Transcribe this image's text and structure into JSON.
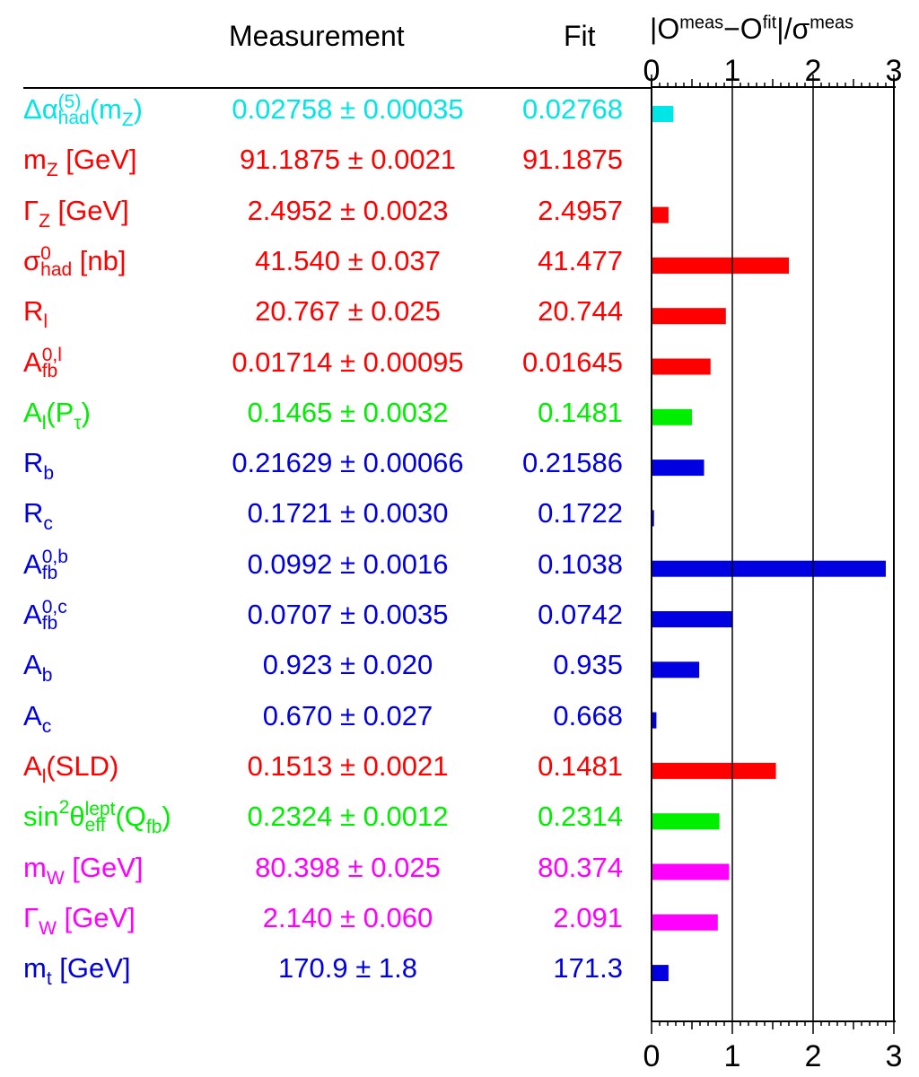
{
  "headers": {
    "measurement": "Measurement",
    "fit": "Fit",
    "pull_O": "|O",
    "pull_meas_sup": "meas",
    "pull_minus_O": "−O",
    "pull_fit_sup": "fit",
    "pull_sigma": "|/σ",
    "pull_sigma_sup": "meas"
  },
  "chart_data": {
    "type": "bar",
    "orientation": "horizontal",
    "xlabel": "|O^meas−O^fit|/σ^meas",
    "xlim": [
      0,
      3
    ],
    "xticks": [
      "0",
      "1",
      "2",
      "3"
    ],
    "grid_x": [
      1,
      2
    ],
    "rows": [
      {
        "label_main": "Δα",
        "label_sup": "(5)",
        "label_sub": "had",
        "label_tail": "(m",
        "label_tail_sub": "Z",
        "label_end": ")",
        "measurement": "0.02758 ± 0.00035",
        "fit": "0.02768",
        "pull": 0.27,
        "color": "#00e5e5"
      },
      {
        "label_main": "m",
        "label_sub": "Z",
        "label_end": " [GeV]",
        "measurement": "91.1875 ± 0.0021",
        "fit": "91.1875",
        "pull": 0.0,
        "color": "#ff0000"
      },
      {
        "label_main": "Γ",
        "label_sub": "Z",
        "label_end": " [GeV]",
        "measurement": "2.4952 ± 0.0023",
        "fit": "2.4957",
        "pull": 0.21,
        "color": "#ff0000"
      },
      {
        "label_main": "σ",
        "label_sup": "0",
        "label_sub": "had",
        "label_end": " [nb]",
        "measurement": "41.540 ± 0.037",
        "fit": "41.477",
        "pull": 1.7,
        "color": "#ff0000"
      },
      {
        "label_main": "R",
        "label_sub": "l",
        "label_end": "",
        "measurement": "20.767 ± 0.025",
        "fit": "20.744",
        "pull": 0.92,
        "color": "#ff0000"
      },
      {
        "label_main": "A",
        "label_sup": "0,l",
        "label_sub": "fb",
        "label_end": "",
        "measurement": "0.01714 ± 0.00095",
        "fit": "0.01645",
        "pull": 0.73,
        "color": "#ff0000"
      },
      {
        "label_main": "A",
        "label_sub": "l",
        "label_end": "(P",
        "label_end_sub": "τ",
        "label_end2": ")",
        "measurement": "0.1465 ± 0.0032",
        "fit": "0.1481",
        "pull": 0.5,
        "color": "#00ee00"
      },
      {
        "label_main": "R",
        "label_sub": "b",
        "label_end": "",
        "measurement": "0.21629 ± 0.00066",
        "fit": "0.21586",
        "pull": 0.65,
        "color": "#0000e0"
      },
      {
        "label_main": "R",
        "label_sub": "c",
        "label_end": "",
        "measurement": "0.1721 ± 0.0030",
        "fit": "0.1722",
        "pull": 0.03,
        "color": "#0000e0"
      },
      {
        "label_main": "A",
        "label_sup": "0,b",
        "label_sub": "fb",
        "label_end": "",
        "measurement": "0.0992 ± 0.0016",
        "fit": "0.1038",
        "pull": 2.9,
        "color": "#0000e0"
      },
      {
        "label_main": "A",
        "label_sup": "0,c",
        "label_sub": "fb",
        "label_end": "",
        "measurement": "0.0707 ± 0.0035",
        "fit": "0.0742",
        "pull": 1.0,
        "color": "#0000e0"
      },
      {
        "label_main": "A",
        "label_sub": "b",
        "label_end": "",
        "measurement": "0.923 ± 0.020",
        "fit": "0.935",
        "pull": 0.59,
        "color": "#0000e0"
      },
      {
        "label_main": "A",
        "label_sub": "c",
        "label_end": "",
        "measurement": "0.670 ± 0.027",
        "fit": "0.668",
        "pull": 0.06,
        "color": "#0000e0"
      },
      {
        "label_main": "A",
        "label_sub": "l",
        "label_end": "(SLD)",
        "measurement": "0.1513 ± 0.0021",
        "fit": "0.1481",
        "pull": 1.54,
        "color": "#ff0000"
      },
      {
        "label_main": "sin",
        "label_sup_simple": "2",
        "label_mid": "θ",
        "label_sup": "lept",
        "label_sub": "eff",
        "label_end": "(Q",
        "label_end_sub": "fb",
        "label_end2": ")",
        "measurement": "0.2324 ± 0.0012",
        "fit": "0.2314",
        "pull": 0.84,
        "color": "#00ee00"
      },
      {
        "label_main": "m",
        "label_sub": "W",
        "label_end": " [GeV]",
        "measurement": "80.398 ± 0.025",
        "fit": "80.374",
        "pull": 0.96,
        "color": "#ff00ff"
      },
      {
        "label_main": "Γ",
        "label_sub": "W",
        "label_end": " [GeV]",
        "measurement": "2.140 ± 0.060",
        "fit": "2.091",
        "pull": 0.82,
        "color": "#ff00ff"
      },
      {
        "label_main": "m",
        "label_sub": "t",
        "label_end": " [GeV]",
        "measurement": "170.9 ± 1.8",
        "fit": "171.3",
        "pull": 0.21,
        "color": "#0000e0"
      }
    ]
  }
}
